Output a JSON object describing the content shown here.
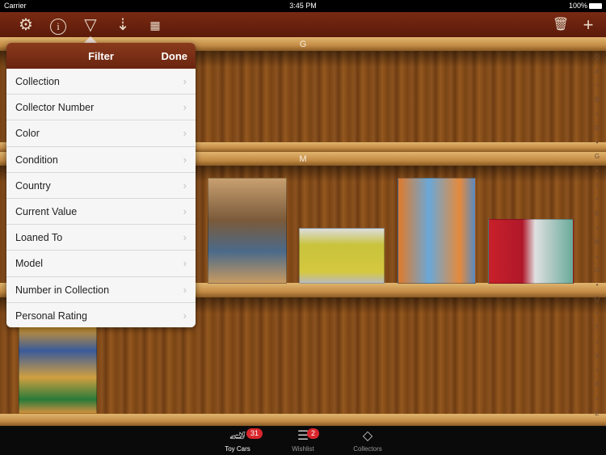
{
  "status": {
    "carrier": "Carrier",
    "time": "3:45 PM",
    "battery": "100%"
  },
  "toolbar": {
    "icons": [
      "gear-icon",
      "info-icon",
      "filter-icon",
      "sort-icon",
      "grid-icon",
      "trash-icon",
      "plus-icon"
    ]
  },
  "shelves": [
    {
      "label": "G"
    },
    {
      "label": "M"
    }
  ],
  "index": [
    "Q",
    "#",
    "•",
    "B",
    "•",
    "D",
    "•",
    "G",
    "•",
    "I",
    "•",
    "K",
    "•",
    "M",
    "•",
    "O",
    "•",
    "Q",
    "•",
    "T",
    "•",
    "V",
    "•",
    "X",
    "•",
    "Z"
  ],
  "filter": {
    "title": "Filter",
    "done": "Done",
    "items": [
      "Collection",
      "Collector Number",
      "Color",
      "Condition",
      "Country",
      "Current Value",
      "Loaned To",
      "Model",
      "Number in Collection",
      "Personal Rating"
    ]
  },
  "tabs": [
    {
      "label": "Toy Cars",
      "badge": "31"
    },
    {
      "label": "Wishlist",
      "badge": "2"
    },
    {
      "label": "Collectors"
    }
  ]
}
